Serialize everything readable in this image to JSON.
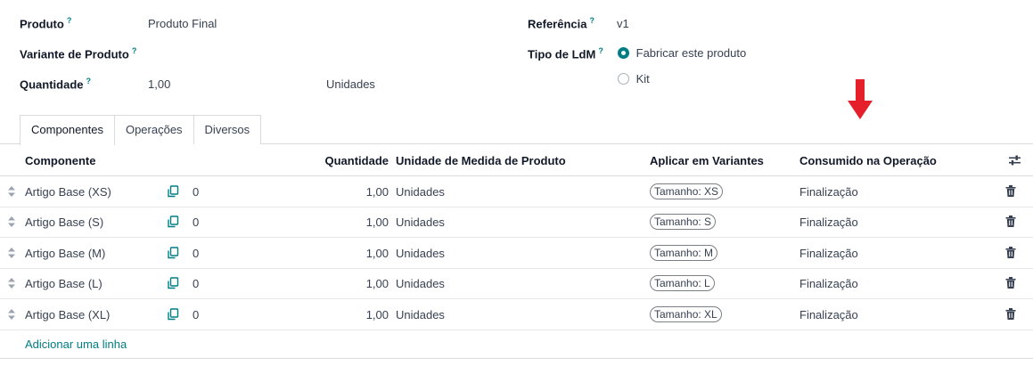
{
  "form": {
    "product_label": "Produto",
    "product_value": "Produto Final",
    "variant_label": "Variante de Produto",
    "quantity_label": "Quantidade",
    "quantity_value": "1,00",
    "uom_value": "Unidades",
    "reference_label": "Referência",
    "reference_value": "v1",
    "bom_type_label": "Tipo de LdM",
    "bom_type_options": [
      "Fabricar este produto",
      "Kit"
    ],
    "bom_type_selected": "Fabricar este produto",
    "help_mark": "?"
  },
  "tabs": [
    "Componentes",
    "Operações",
    "Diversos"
  ],
  "active_tab": "Componentes",
  "table": {
    "columns": [
      "Componente",
      "Quantidade",
      "Unidade de Medida de Produto",
      "Aplicar em Variantes",
      "Consumido na Operação"
    ],
    "rows": [
      {
        "component": "Artigo Base (XS)",
        "count": "0",
        "quantity": "1,00",
        "uom": "Unidades",
        "variant": "Tamanho: XS",
        "operation": "Finalização"
      },
      {
        "component": "Artigo Base (S)",
        "count": "0",
        "quantity": "1,00",
        "uom": "Unidades",
        "variant": "Tamanho: S",
        "operation": "Finalização"
      },
      {
        "component": "Artigo Base (M)",
        "count": "0",
        "quantity": "1,00",
        "uom": "Unidades",
        "variant": "Tamanho: M",
        "operation": "Finalização"
      },
      {
        "component": "Artigo Base (L)",
        "count": "0",
        "quantity": "1,00",
        "uom": "Unidades",
        "variant": "Tamanho: L",
        "operation": "Finalização"
      },
      {
        "component": "Artigo Base (XL)",
        "count": "0",
        "quantity": "1,00",
        "uom": "Unidades",
        "variant": "Tamanho: XL",
        "operation": "Finalização"
      }
    ],
    "add_line": "Adicionar uma linha"
  },
  "colors": {
    "accent": "#017e84",
    "arrow": "#e5202a"
  },
  "icons": [
    "help-icon",
    "radio-icon",
    "drag-handle-icon",
    "copy-icon",
    "trash-icon",
    "optional-columns-icon",
    "arrow-down-icon"
  ]
}
